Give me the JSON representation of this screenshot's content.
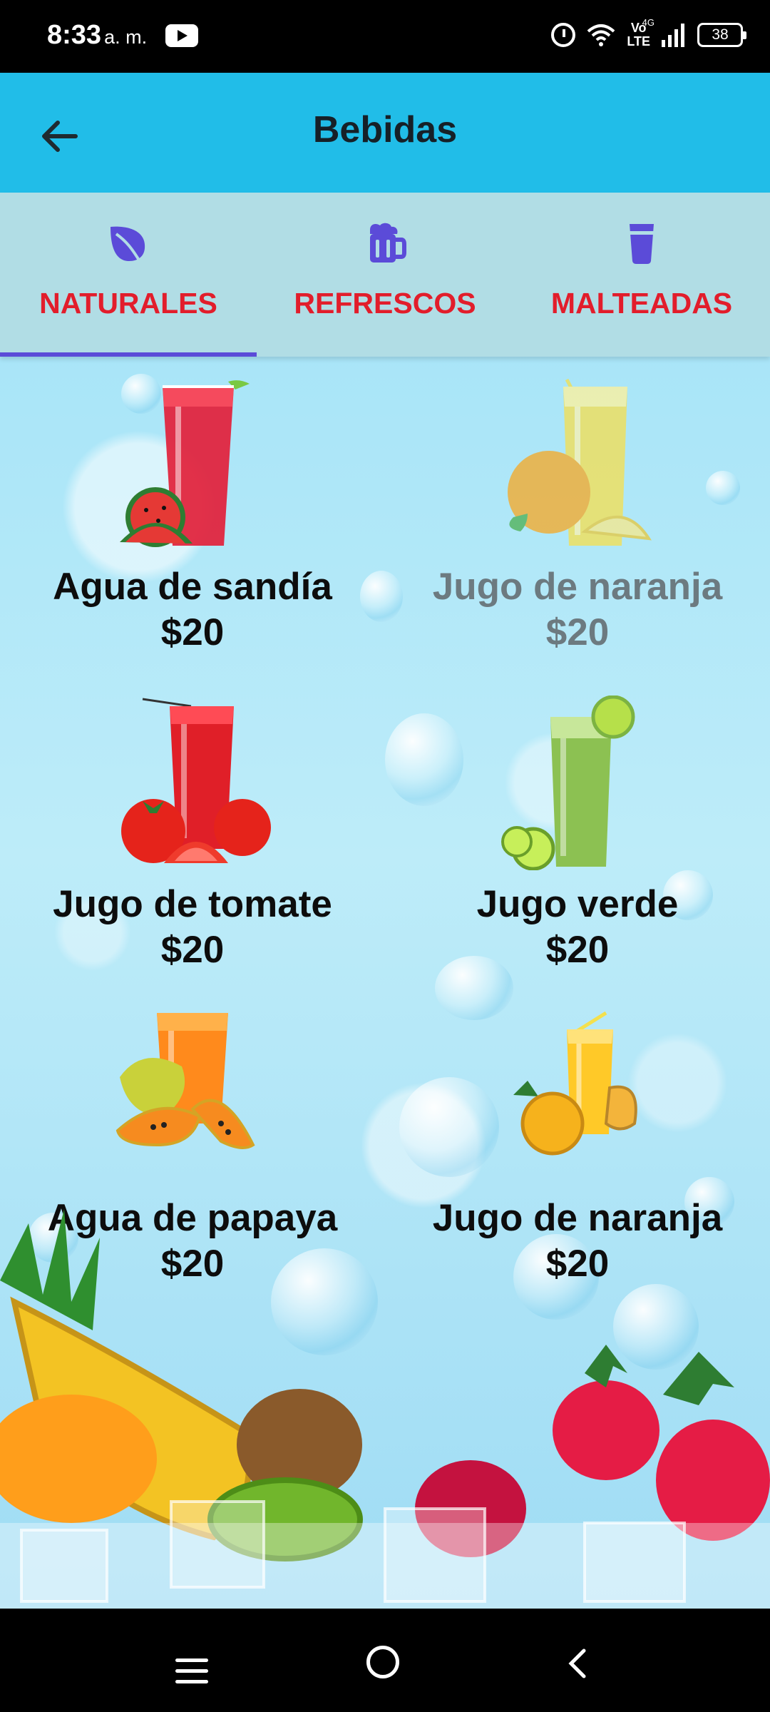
{
  "status_bar": {
    "time": "8:33",
    "ampm": "a. m.",
    "network_small": "4G",
    "volte_top": "Vo",
    "volte_bottom": "LTE",
    "battery": "38"
  },
  "app_bar": {
    "title": "Bebidas",
    "back_icon": "arrow-left-icon"
  },
  "tabs": [
    {
      "label": "NATURALES",
      "icon": "leaf-icon",
      "selected": true
    },
    {
      "label": "REFRESCOS",
      "icon": "beer-mug-icon",
      "selected": false
    },
    {
      "label": "MALTEADAS",
      "icon": "cup-icon",
      "selected": false
    }
  ],
  "colors": {
    "app_bar": "#21bde8",
    "tab_bar": "#b1dde5",
    "tab_label": "#e21d2b",
    "tab_icon": "#5b4bd8",
    "indicator": "#5b4bd8"
  },
  "items": [
    {
      "name": "Agua de sandía",
      "price": "$20"
    },
    {
      "name": "Jugo de naranja",
      "price": "$20"
    },
    {
      "name": "Jugo de tomate",
      "price": "$20"
    },
    {
      "name": "Jugo verde",
      "price": "$20"
    },
    {
      "name": "Agua de papaya",
      "price": "$20"
    },
    {
      "name": "Jugo de naranja",
      "price": "$20"
    }
  ],
  "nav_bar": {
    "menu_icon": "menu-icon",
    "home_icon": "home-circle-icon",
    "back_icon": "chevron-left-icon"
  }
}
